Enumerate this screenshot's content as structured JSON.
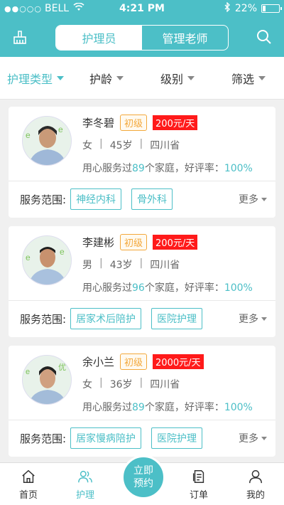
{
  "status": {
    "signal": "●●○○○",
    "carrier": "BELL",
    "time": "4:21 PM",
    "battery": "22%",
    "battery_level": 0.22
  },
  "header": {
    "tabs": [
      {
        "label": "护理员",
        "active": true
      },
      {
        "label": "管理老师",
        "active": false
      }
    ]
  },
  "filters": [
    {
      "label": "护理类型",
      "active": true
    },
    {
      "label": "护龄",
      "active": false
    },
    {
      "label": "级别",
      "active": false
    },
    {
      "label": "筛选",
      "active": false
    }
  ],
  "caregivers": [
    {
      "name": "李冬碧",
      "level": "初级",
      "price": "200元/天",
      "gender": "女",
      "age": "45岁",
      "province": "四川省",
      "served_prefix": "用心服务过",
      "served_count": "89",
      "served_suffix": "个家庭，好评率：",
      "rating": "100%",
      "scope_label": "服务范围:",
      "tags": [
        "神经内科",
        "骨外科"
      ],
      "more": "更多"
    },
    {
      "name": "李建彬",
      "level": "初级",
      "price": "200元/天",
      "gender": "男",
      "age": "43岁",
      "province": "四川省",
      "served_prefix": "用心服务过",
      "served_count": "96",
      "served_suffix": "个家庭，好评率：",
      "rating": "100%",
      "scope_label": "服务范围:",
      "tags": [
        "居家术后陪护",
        "医院护理"
      ],
      "more": "更多"
    },
    {
      "name": "余小兰",
      "level": "初级",
      "price": "2000元/天",
      "gender": "女",
      "age": "36岁",
      "province": "四川省",
      "served_prefix": "用心服务过",
      "served_count": "89",
      "served_suffix": "个家庭，好评率：",
      "rating": "100%",
      "scope_label": "服务范围:",
      "tags": [
        "居家慢病陪护",
        "医院护理"
      ],
      "more": "更多"
    }
  ],
  "tabbar": {
    "home": "首页",
    "care": "护理",
    "book_line1": "立即",
    "book_line2": "预约",
    "orders": "订单",
    "mine": "我的"
  },
  "colors": {
    "accent": "#4cbfc7",
    "price": "#ff1a1a",
    "level": "#f3a83b"
  }
}
